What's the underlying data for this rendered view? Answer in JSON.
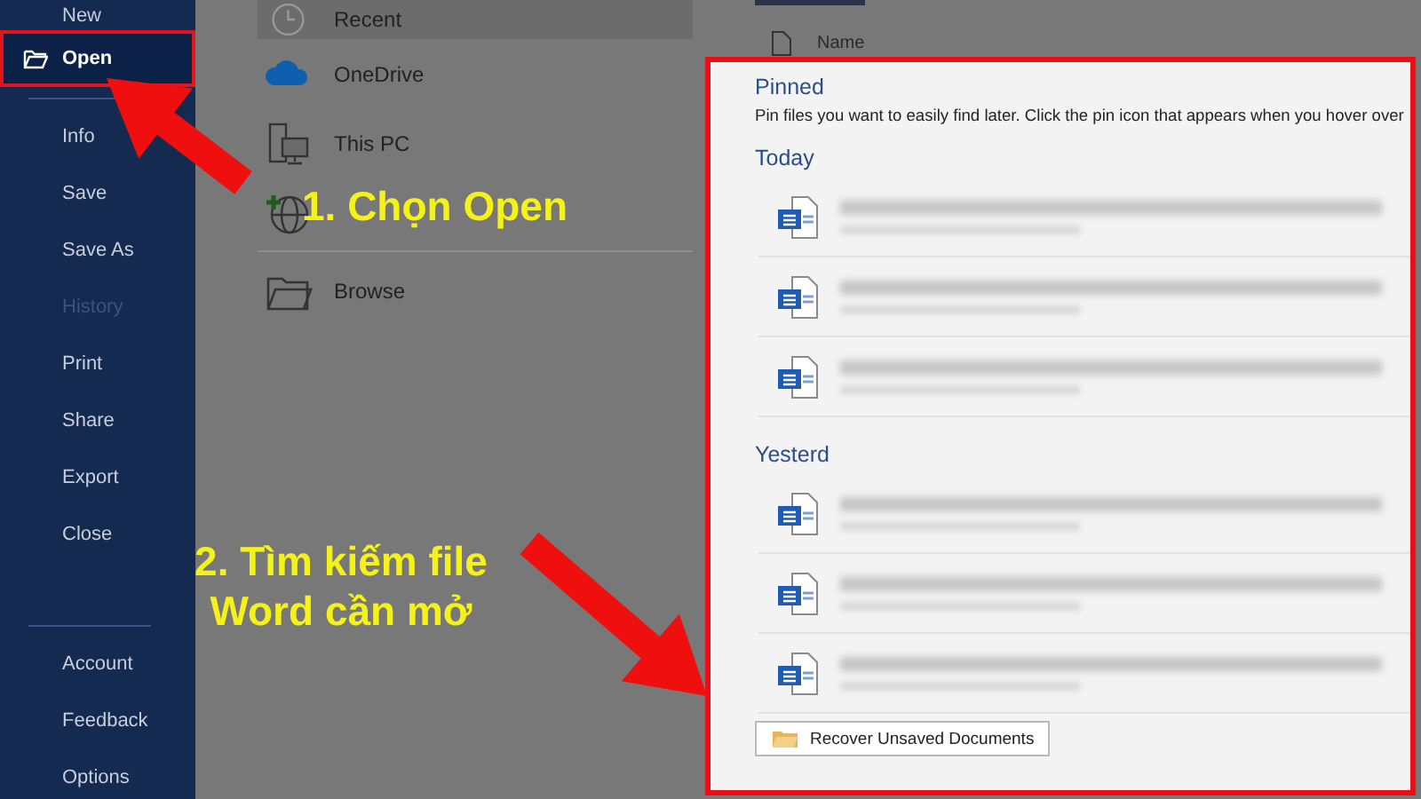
{
  "sidebar": {
    "top_items": [
      {
        "label": "New",
        "selected": false,
        "disabled": false
      },
      {
        "label": "Open",
        "selected": true,
        "disabled": false
      }
    ],
    "main_items": [
      {
        "label": "Info",
        "selected": false,
        "disabled": false
      },
      {
        "label": "Save",
        "selected": false,
        "disabled": false
      },
      {
        "label": "Save As",
        "selected": false,
        "disabled": false
      },
      {
        "label": "History",
        "selected": false,
        "disabled": true
      },
      {
        "label": "Print",
        "selected": false,
        "disabled": false
      },
      {
        "label": "Share",
        "selected": false,
        "disabled": false
      },
      {
        "label": "Export",
        "selected": false,
        "disabled": false
      },
      {
        "label": "Close",
        "selected": false,
        "disabled": false
      }
    ],
    "footer_items": [
      {
        "label": "Account",
        "selected": false,
        "disabled": false
      },
      {
        "label": "Feedback",
        "selected": false,
        "disabled": false
      },
      {
        "label": "Options",
        "selected": false,
        "disabled": false
      }
    ]
  },
  "locations": [
    {
      "kind": "clock",
      "label": "Recent",
      "selected": true
    },
    {
      "kind": "cloud",
      "label": "OneDrive",
      "selected": false
    },
    {
      "kind": "computer",
      "label": "This PC",
      "selected": false
    },
    {
      "kind": "globe",
      "selected": false
    },
    {
      "kind": "folder",
      "label": "Browse",
      "selected": false
    }
  ],
  "file_list": {
    "column": "Name",
    "pinned": {
      "title": "Pinned",
      "hint": "Pin files you want to easily find later. Click the pin icon that appears when you hover over"
    },
    "groups": [
      {
        "title": "Today",
        "rows": [
          {
            "kind": "blurred"
          },
          {
            "kind": "blurred"
          },
          {
            "kind": "blurred"
          }
        ]
      },
      {
        "title": "Yesterd",
        "rows": [
          {
            "kind": "blurred"
          },
          {
            "kind": "blurred"
          },
          {
            "kind": "blurred"
          }
        ]
      }
    ],
    "button": "Recover Unsaved Documents"
  },
  "annotations": [
    {
      "kind": "step1",
      "text": "1. Chọn Open"
    },
    {
      "kind": "step2",
      "text": "2. Tìm kiếm file Word cần mở"
    }
  ]
}
